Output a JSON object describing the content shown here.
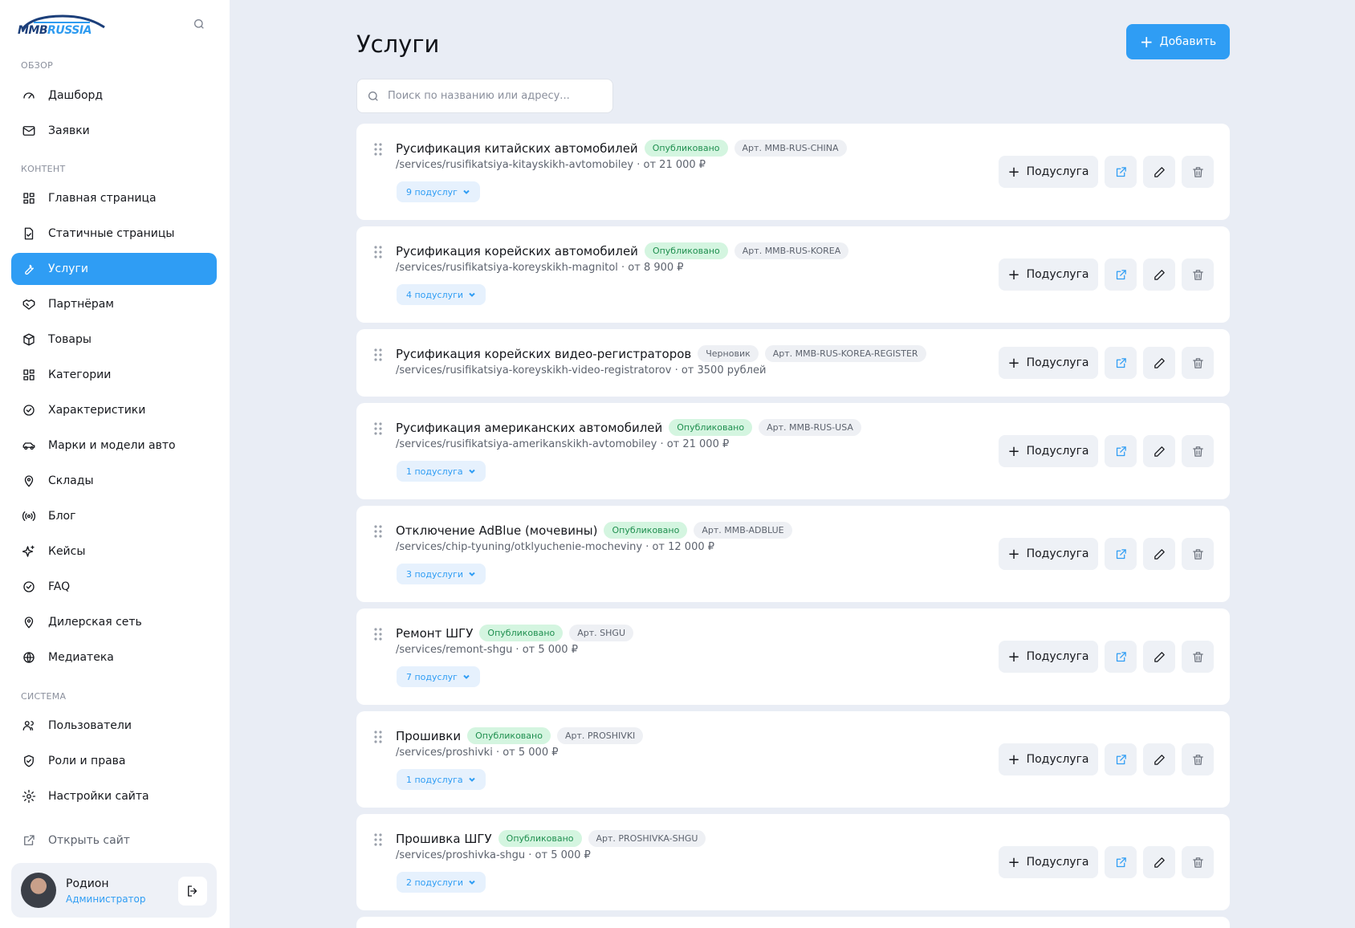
{
  "sidebar": {
    "logo": {
      "text_1": "MMB",
      "text_2": "RUSSIA"
    },
    "section_overview": "ОБЗОР",
    "section_content": "КОНТЕНТ",
    "section_system": "СИСТЕМА",
    "items": [
      {
        "label": "Дашборд",
        "icon": "dashboard-icon"
      },
      {
        "label": "Заявки",
        "icon": "mail-icon"
      },
      {
        "label": "Главная страница",
        "icon": "grid-icon"
      },
      {
        "label": "Статичные страницы",
        "icon": "document-icon"
      },
      {
        "label": "Услуги",
        "icon": "wrench-icon"
      },
      {
        "label": "Партнёрам",
        "icon": "handshake-icon"
      },
      {
        "label": "Товары",
        "icon": "box-icon"
      },
      {
        "label": "Категории",
        "icon": "grid-icon"
      },
      {
        "label": "Характеристики",
        "icon": "check-circle-icon"
      },
      {
        "label": "Марки и модели авто",
        "icon": "car-icon"
      },
      {
        "label": "Склады",
        "icon": "map-pin-icon"
      },
      {
        "label": "Блог",
        "icon": "broadcast-icon"
      },
      {
        "label": "Кейсы",
        "icon": "sparkle-icon"
      },
      {
        "label": "FAQ",
        "icon": "check-circle-icon"
      },
      {
        "label": "Дилерская сеть",
        "icon": "map-pin-icon"
      },
      {
        "label": "Медиатека",
        "icon": "globe-icon"
      },
      {
        "label": "Пользователи",
        "icon": "users-icon"
      },
      {
        "label": "Роли и права",
        "icon": "shield-icon"
      },
      {
        "label": "Настройки сайта",
        "icon": "gear-icon"
      },
      {
        "label": "Открыть сайт",
        "icon": "external-link-icon"
      }
    ],
    "active_item": "Услуги",
    "user": {
      "name": "Родион",
      "role": "Администратор"
    }
  },
  "main": {
    "title": "Услуги",
    "add_button": "Добавить",
    "search_placeholder": "Поиск по названию или адресу...",
    "subservice_button": "Подуслуга",
    "services": [
      {
        "title": "Русификация китайских автомобилей",
        "status": "Опубликовано",
        "status_type": "published",
        "sku": "Арт. MMB-RUS-CHINA",
        "path": "/services/rusifikatsiya-kitayskikh-avtomobiley · от 21 000 ₽",
        "subservices": "9 подуслуг"
      },
      {
        "title": "Русификация корейских автомобилей",
        "status": "Опубликовано",
        "status_type": "published",
        "sku": "Арт. MMB-RUS-KOREA",
        "path": "/services/rusifikatsiya-koreyskikh-magnitol · от 8 900 ₽",
        "subservices": "4 подуслуги"
      },
      {
        "title": "Русификация корейских видео-регистраторов",
        "status": "Черновик",
        "status_type": "draft",
        "sku": "Арт. MMB-RUS-KOREA-REGISTER",
        "path": "/services/rusifikatsiya-koreyskikh-video-registratorov · от 3500 рублей",
        "subservices": ""
      },
      {
        "title": "Русификация американских автомобилей",
        "status": "Опубликовано",
        "status_type": "published",
        "sku": "Арт. MMB-RUS-USA",
        "path": "/services/rusifikatsiya-amerikanskikh-avtomobiley · от 21 000 ₽",
        "subservices": "1 подуслуга"
      },
      {
        "title": "Отключение AdBlue (мочевины)",
        "status": "Опубликовано",
        "status_type": "published",
        "sku": "Арт. MMB-ADBLUE",
        "path": "/services/chip-tyuning/otklyuchenie-mocheviny · от 12 000 ₽",
        "subservices": "3 подуслуги"
      },
      {
        "title": "Ремонт ШГУ",
        "status": "Опубликовано",
        "status_type": "published",
        "sku": "Арт. SHGU",
        "path": "/services/remont-shgu · от 5 000 ₽",
        "subservices": "7 подуслуг"
      },
      {
        "title": "Прошивки",
        "status": "Опубликовано",
        "status_type": "published",
        "sku": "Арт. PROSHIVKI",
        "path": "/services/proshivki · от 5 000 ₽",
        "subservices": "1 подуслуга"
      },
      {
        "title": "Прошивка ШГУ",
        "status": "Опубликовано",
        "status_type": "published",
        "sku": "Арт. PROSHIVKA-SHGU",
        "path": "/services/proshivka-shgu · от 5 000 ₽",
        "subservices": "2 подуслуги"
      }
    ]
  },
  "colors": {
    "accent": "#2f9df4",
    "published_bg": "#d4f5e0",
    "published_text": "#1f8f4f",
    "background": "#e9edf5"
  }
}
